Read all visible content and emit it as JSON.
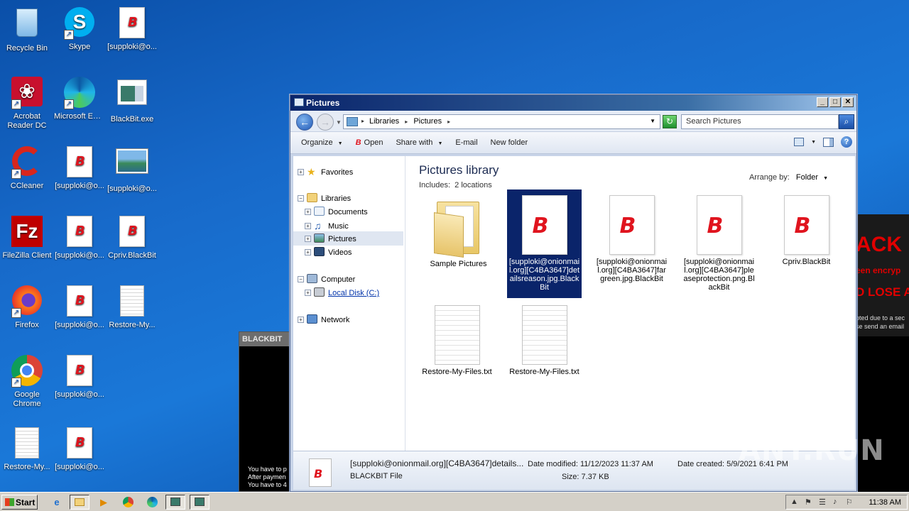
{
  "desktop": {
    "icons": [
      {
        "label": "Recycle Bin"
      },
      {
        "label": "Skype"
      },
      {
        "label": "[supploki@o..."
      },
      {
        "label": "Acrobat Reader DC"
      },
      {
        "label": "Microsoft Edge"
      },
      {
        "label": "BlackBit.exe"
      },
      {
        "label": "CCleaner"
      },
      {
        "label": "[supploki@o..."
      },
      {
        "label": "[supploki@o..."
      },
      {
        "label": "FileZilla Client"
      },
      {
        "label": "[supploki@o..."
      },
      {
        "label": "Cpriv.BlackBit"
      },
      {
        "label": "Firefox"
      },
      {
        "label": "[supploki@o..."
      },
      {
        "label": "Restore-My..."
      },
      {
        "label": "Google Chrome"
      },
      {
        "label": "[supploki@o..."
      },
      {
        "label": "Restore-My..."
      },
      {
        "label": "[supploki@o..."
      }
    ]
  },
  "blackbit_window": {
    "title": "BLACKBIT",
    "lines": [
      "You have to p",
      "After paymen",
      "You have to 4"
    ]
  },
  "ransom_window": {
    "line1": "ACK I",
    "line2": "een encryp",
    "line3": "D LOSE A",
    "line4": "pted due to a sec",
    "line5": "se send an email"
  },
  "explorer": {
    "title": "Pictures",
    "title_buttons": [
      "_",
      "□",
      "✕"
    ],
    "breadcrumb": [
      "Libraries",
      "Pictures"
    ],
    "search_placeholder": "Search Pictures",
    "toolbar": {
      "organize": "Organize",
      "open": "Open",
      "share_with": "Share with",
      "email": "E-mail",
      "new_folder": "New folder"
    },
    "nav": {
      "favorites": "Favorites",
      "libraries": "Libraries",
      "documents": "Documents",
      "music": "Music",
      "pictures": "Pictures",
      "videos": "Videos",
      "computer": "Computer",
      "local_disk": "Local Disk (C:)",
      "network": "Network"
    },
    "library_title": "Pictures library",
    "includes_label": "Includes:",
    "includes_value": "2 locations",
    "arrange_label": "Arrange by:",
    "arrange_value": "Folder",
    "files": [
      {
        "name": "Sample Pictures",
        "kind": "folder",
        "selected": false
      },
      {
        "name": "[supploki@onionmail.org][C4BA3647]detailsreason.jpg.BlackBit",
        "kind": "blackbit",
        "selected": true
      },
      {
        "name": "[supploki@onionmail.org][C4BA3647]fargreen.jpg.BlackBit",
        "kind": "blackbit",
        "selected": false
      },
      {
        "name": "[supploki@onionmail.org][C4BA3647]pleaseprotection.png.BlackBit",
        "kind": "blackbit",
        "selected": false
      },
      {
        "name": "Cpriv.BlackBit",
        "kind": "blackbit",
        "selected": false
      },
      {
        "name": "Restore-My-Files.txt",
        "kind": "txt",
        "selected": false
      },
      {
        "name": "Restore-My-Files.txt",
        "kind": "txt",
        "selected": false
      }
    ],
    "details": {
      "name": "[supploki@onionmail.org][C4BA3647]details...",
      "type": "BLACKBIT File",
      "date_modified_label": "Date modified:",
      "date_modified": "11/12/2023 11:37 AM",
      "size_label": "Size:",
      "size": "7.37 KB",
      "date_created_label": "Date created:",
      "date_created": "5/9/2021 6:41 PM"
    }
  },
  "taskbar": {
    "start": "Start",
    "clock": "11:38 AM"
  },
  "watermark": "ANY.RUN"
}
